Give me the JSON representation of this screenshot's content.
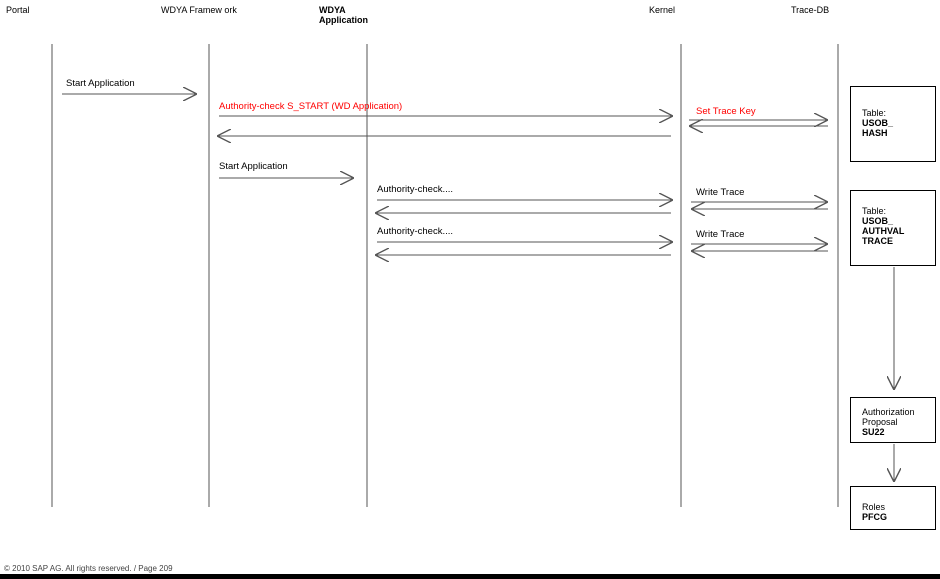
{
  "lanes": {
    "portal": "Portal",
    "framework": "WDYA Framew ork",
    "application": "WDYA Application",
    "kernel": "Kernel",
    "trace_db": "Trace-DB"
  },
  "messages": {
    "start_app_1": "Start Application",
    "auth_check_start": "Authority-check S_START  (WD Application)",
    "set_trace_key": "Set Trace Key",
    "start_app_2": "Start Application",
    "auth_check_1": "Authority-check....",
    "write_trace_1": "Write Trace",
    "auth_check_2": "Authority-check....",
    "write_trace_2": "Write Trace"
  },
  "boxes": {
    "usob_hash": {
      "line1": "Table:",
      "line2": "USOB_ HASH"
    },
    "usob_authval": {
      "line1": "Table:",
      "line2": "USOB_ AUTHVAL TRACE"
    },
    "su22": {
      "line1": "Authorization Proposal",
      "line2": "SU22"
    },
    "pfcg": {
      "line1": "Roles",
      "line2": "PFCG"
    }
  },
  "colors": {
    "highlight": "#ff0000",
    "line": "#555555"
  },
  "footer": {
    "copyright": "© 2010 SAP AG. All rights reserved. / Page 209"
  }
}
